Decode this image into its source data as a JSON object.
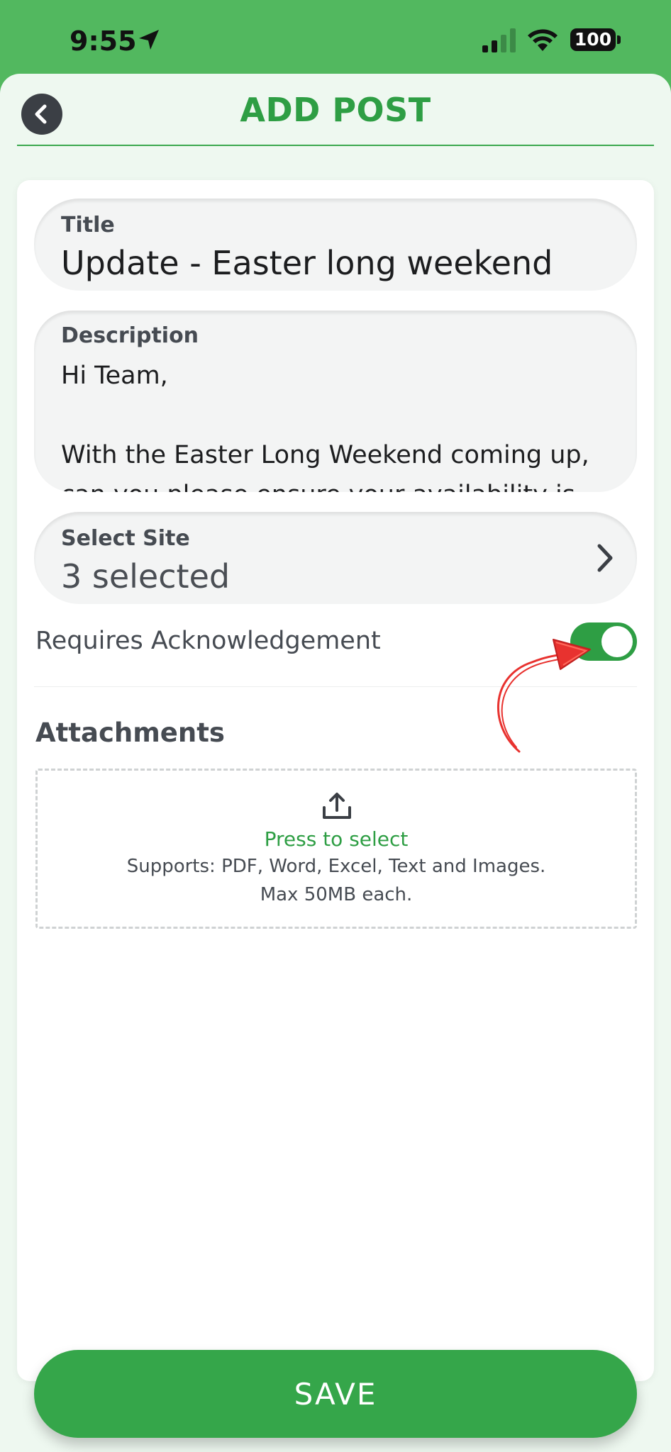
{
  "status_bar": {
    "time": "9:55",
    "battery": "100",
    "icons": [
      "location-arrow-icon",
      "cellular-signal-icon",
      "wifi-icon",
      "battery-icon"
    ]
  },
  "header": {
    "title": "ADD POST",
    "back_icon": "chevron-left-icon"
  },
  "form": {
    "title_field": {
      "label": "Title",
      "value": "Update - Easter long weekend"
    },
    "description_field": {
      "label": "Description",
      "value": "Hi Team,\n\nWith the Easter Long Weekend coming up,\ncan you please ensure your availability is"
    },
    "site_field": {
      "label": "Select Site",
      "value": "3 selected",
      "icon": "chevron-right-icon"
    },
    "acknowledgement": {
      "label": "Requires Acknowledgement",
      "enabled": true
    },
    "attachments": {
      "heading": "Attachments",
      "icon": "upload-icon",
      "prompt": "Press to select",
      "supports": "Supports: PDF, Word, Excel, Text and Images.",
      "max_size": "Max 50MB each."
    }
  },
  "save_label": "SAVE",
  "colors": {
    "brand_green": "#2e9e44",
    "status_bar_green": "#52b85f",
    "annotation_red": "#e8322f"
  }
}
